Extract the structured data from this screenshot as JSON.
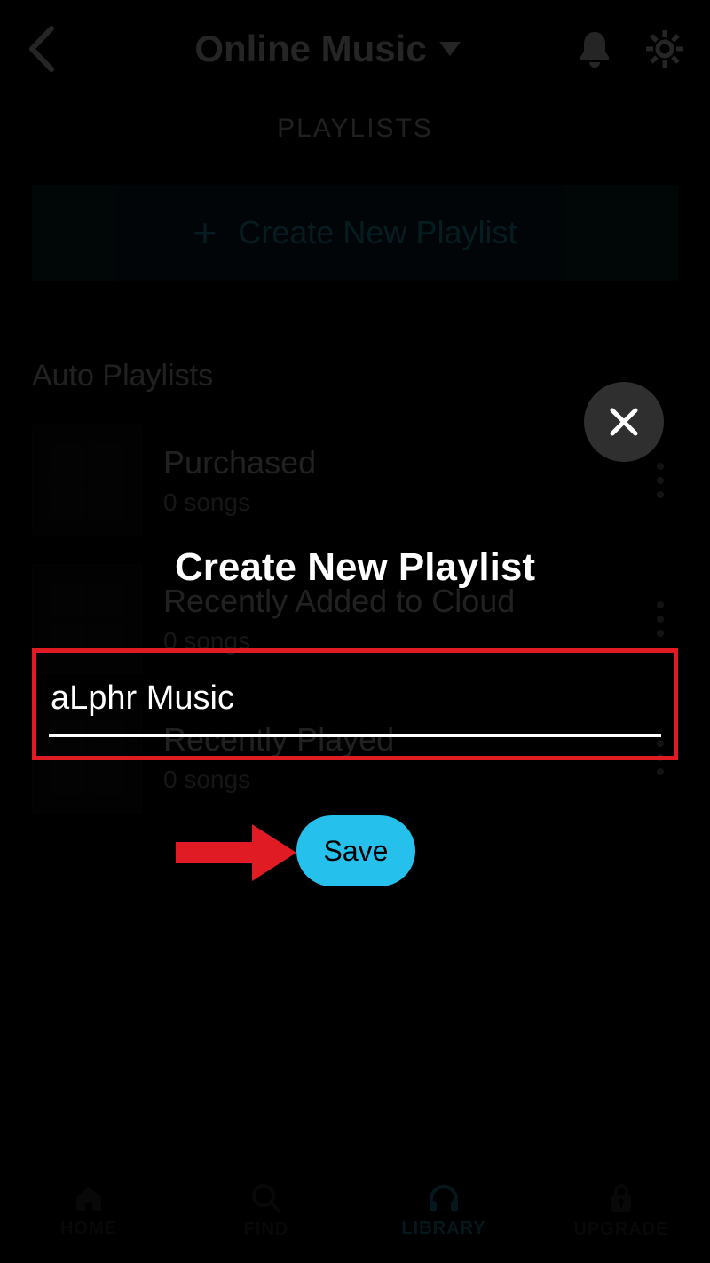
{
  "header": {
    "title": "Online Music"
  },
  "tabs": {
    "playlists": "PLAYLISTS"
  },
  "create_bar": {
    "label": "Create New Playlist"
  },
  "auto_playlists": {
    "heading": "Auto Playlists",
    "items": [
      {
        "title": "Purchased",
        "sub": "0 songs"
      },
      {
        "title": "Recently Added to Cloud",
        "sub": "0 songs"
      },
      {
        "title": "Recently Played",
        "sub": "0 songs"
      }
    ]
  },
  "modal": {
    "title": "Create New Playlist",
    "input_value": "aLphr Music",
    "save_label": "Save"
  },
  "nav": {
    "home": "HOME",
    "find": "FIND",
    "library": "LIBRARY",
    "upgrade": "UPGRADE"
  },
  "colors": {
    "accent": "#25c1ec",
    "highlight": "#e01b24"
  }
}
